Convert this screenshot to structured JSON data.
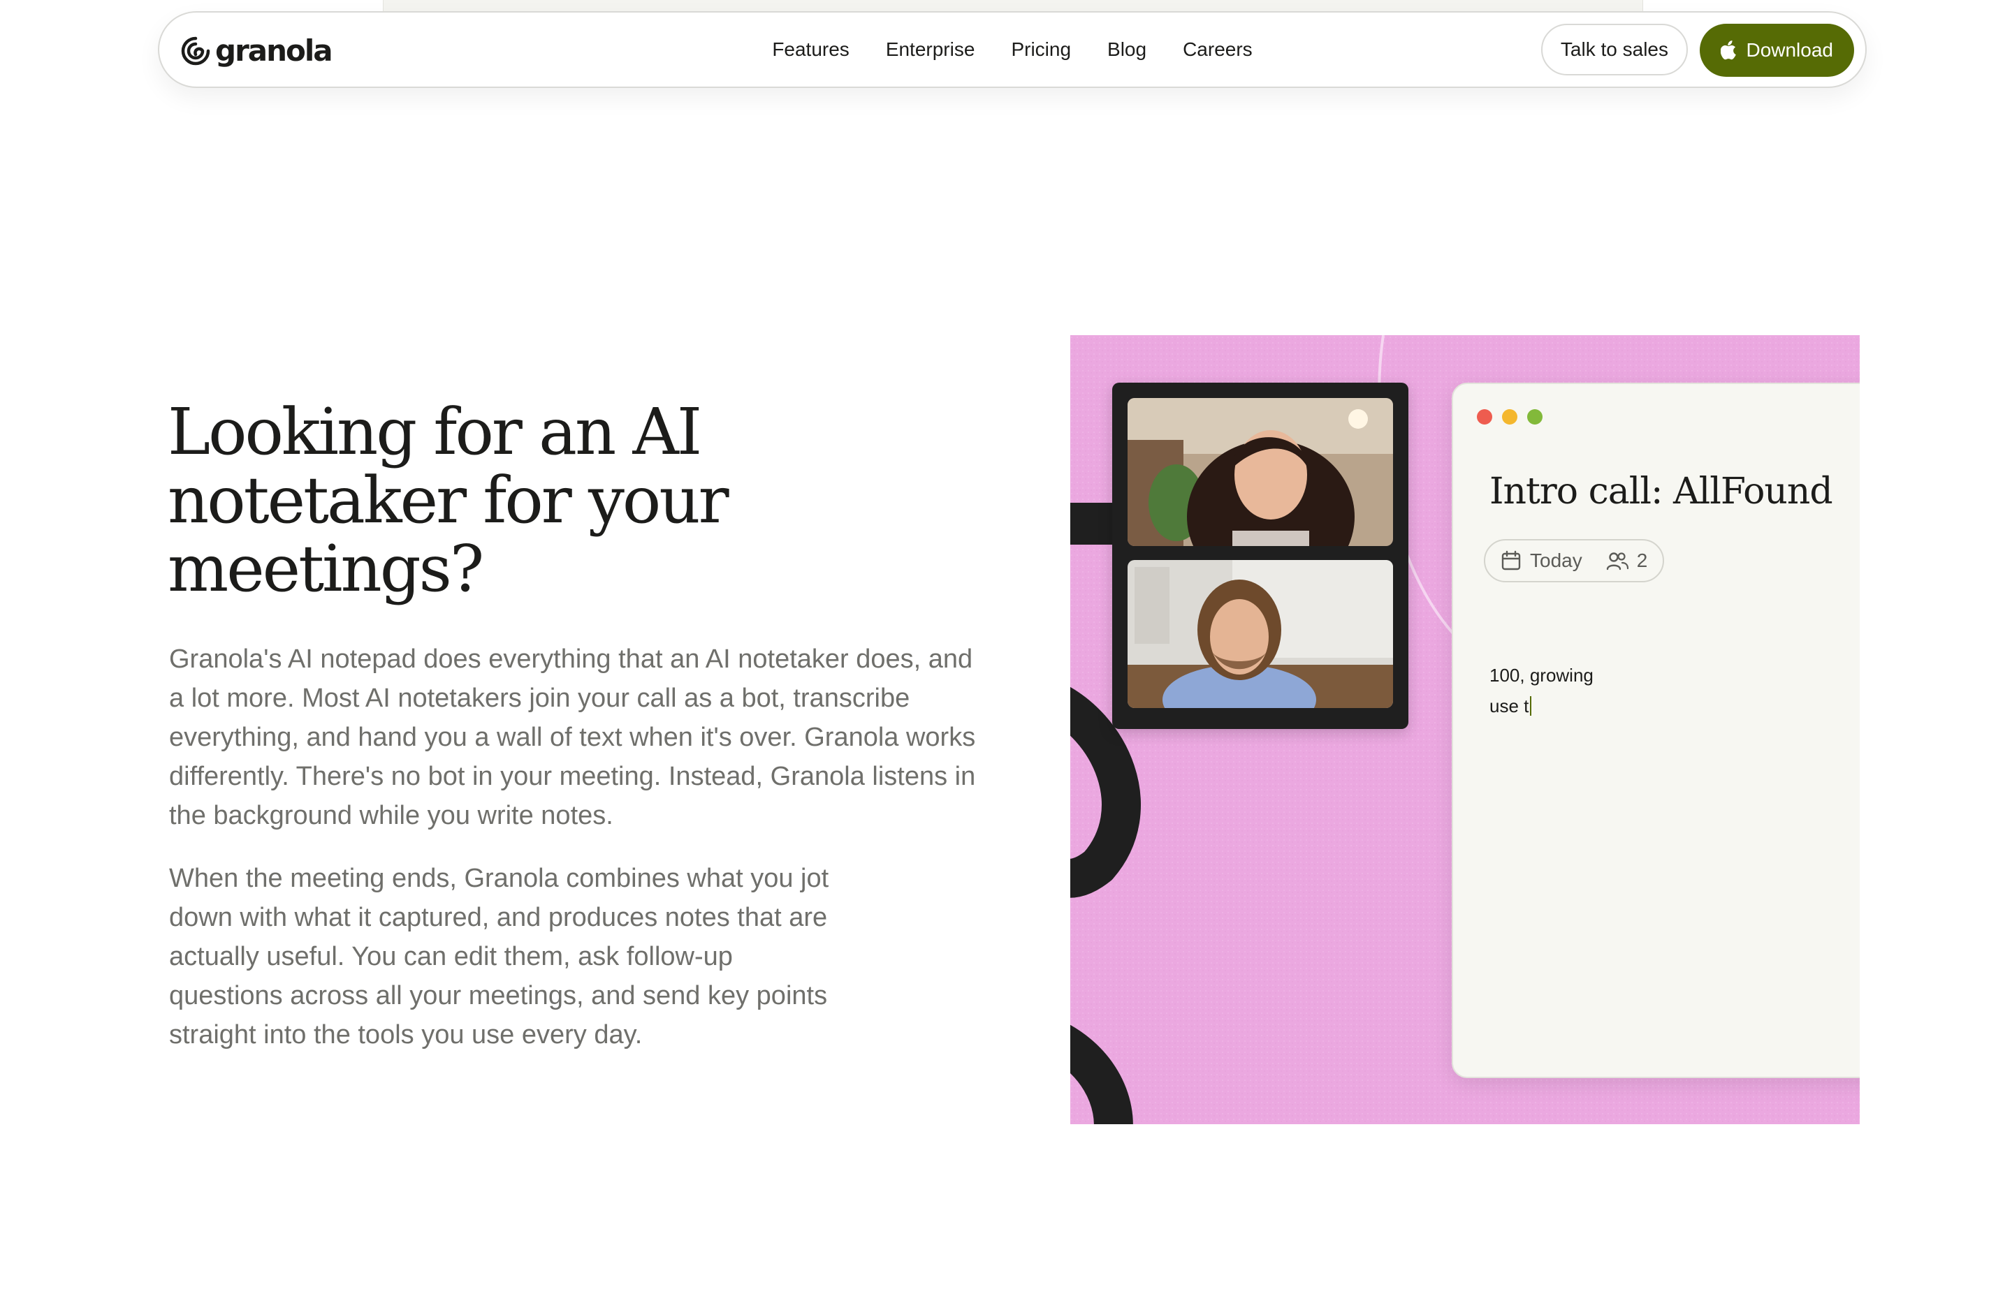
{
  "nav": {
    "logo_text": "granola",
    "links": [
      {
        "label": "Features"
      },
      {
        "label": "Enterprise"
      },
      {
        "label": "Pricing"
      },
      {
        "label": "Blog"
      },
      {
        "label": "Careers"
      }
    ],
    "talk_to_sales_label": "Talk to sales",
    "download_label": "Download",
    "download_icon": "apple-icon",
    "accent_color": "#566b05"
  },
  "hero": {
    "title": "Looking for an AI notetaker for your meetings?",
    "paragraph_1": "Granola's AI notepad does everything that an AI notetaker does, and a lot more. Most AI notetakers join your call as a bot, transcribe everything, and hand you a wall of text when it's over. Granola works differently. There's no bot in your meeting. Instead, Granola listens in the background while you write notes.",
    "paragraph_2": "When the meeting ends, Granola combines what you jot down with what it captured, and produces notes that are actually useful. You can edit them, ask follow-up questions across all your meetings, and send key points straight into the tools you use every day."
  },
  "illustration": {
    "background_color": "#eba8e0",
    "note": {
      "title": "Intro call: AllFound",
      "date_label": "Today",
      "attendee_count": "2",
      "lines": [
        "100, growing",
        "use t"
      ]
    }
  }
}
